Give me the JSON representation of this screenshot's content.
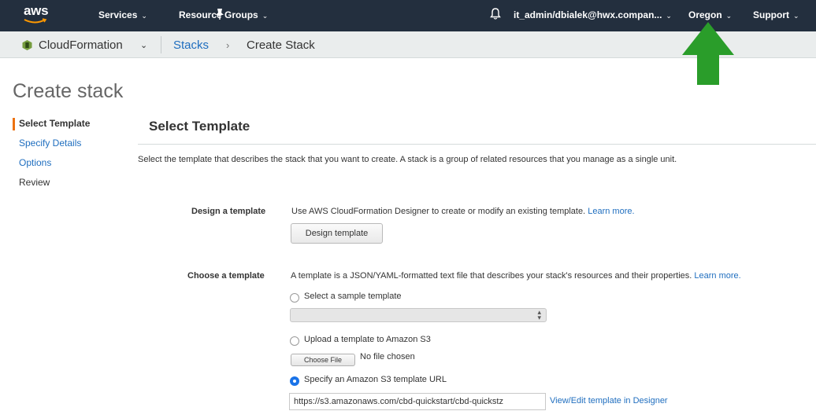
{
  "topnav": {
    "logo": "aws",
    "services_label": "Services",
    "resource_groups_label": "Resource Groups",
    "account_label": "it_admin/dbialek@hwx.compan...",
    "region_label": "Oregon",
    "support_label": "Support",
    "bg_color": "#232f3e",
    "icons": [
      "pin-icon",
      "bell-icon",
      "caret-down-icon"
    ]
  },
  "subnav": {
    "service_label": "CloudFormation",
    "breadcrumb": [
      "Stacks",
      "Create Stack"
    ]
  },
  "annotation": {
    "arrow_color": "#2a9d2a"
  },
  "page": {
    "title": "Create stack"
  },
  "steps": [
    {
      "label": "Select Template"
    },
    {
      "label": "Specify Details"
    },
    {
      "label": "Options"
    },
    {
      "label": "Review"
    }
  ],
  "main": {
    "section_title": "Select Template",
    "intro": "Select the template that describes the stack that you want to create. A stack is a group of related resources that you manage as a single unit.",
    "design": {
      "label": "Design a template",
      "description": "Use AWS CloudFormation Designer to create or modify an existing template.",
      "learn_more": "Learn more.",
      "button": "Design template"
    },
    "choose": {
      "label": "Choose a template",
      "description": "A template is a JSON/YAML-formatted text file that describes your stack's resources and their properties.",
      "learn_more": "Learn more.",
      "options": [
        {
          "label": "Select a sample template",
          "checked": false
        },
        {
          "label": "Upload a template to Amazon S3",
          "checked": false
        },
        {
          "label": "Specify an Amazon S3 template URL",
          "checked": true
        }
      ],
      "sample_select_value": "",
      "choose_file_button": "Choose File",
      "no_file_text": "No file chosen",
      "url_value": "https://s3.amazonaws.com/cbd-quickstart/cbd-quickstz",
      "view_edit_link": "View/Edit template in Designer"
    }
  },
  "colors": {
    "accent": "#ec7211",
    "link": "#1f6ebf",
    "radio_selected": "#1a73e8"
  }
}
